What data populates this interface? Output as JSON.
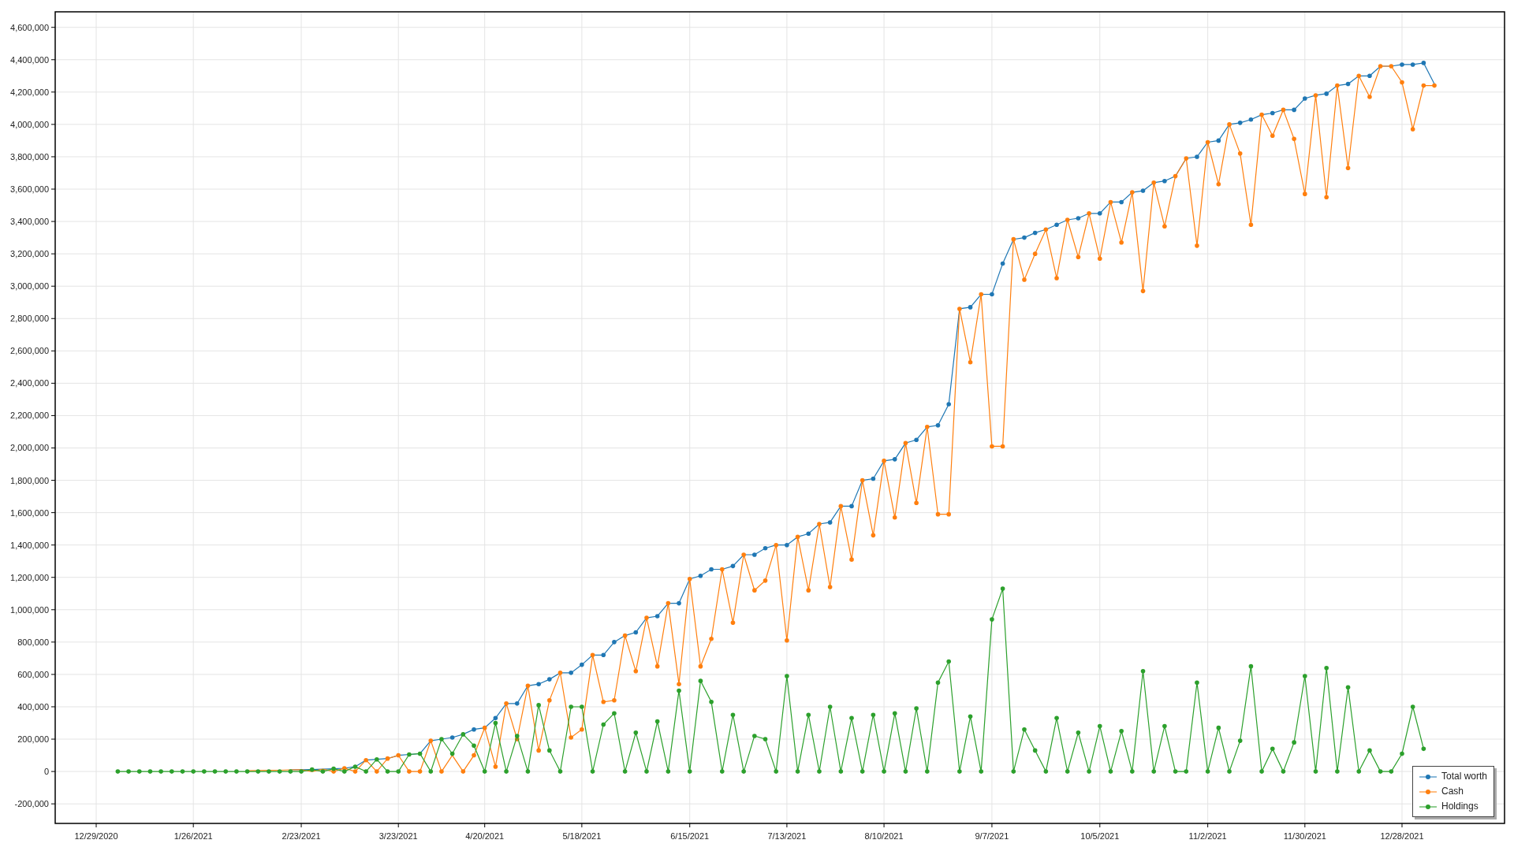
{
  "chart": {
    "chart_data": {
      "type": "line",
      "categories": [
        "12/29/2020",
        null,
        null,
        null,
        null,
        null,
        null,
        null,
        null,
        "1/26/2021",
        null,
        null,
        null,
        null,
        null,
        null,
        null,
        null,
        null,
        "2/23/2021",
        null,
        null,
        null,
        null,
        null,
        null,
        null,
        null,
        "3/23/2021",
        null,
        null,
        null,
        null,
        null,
        null,
        null,
        "4/20/2021",
        null,
        null,
        null,
        null,
        null,
        null,
        null,
        null,
        "5/18/2021",
        null,
        null,
        null,
        null,
        null,
        null,
        null,
        null,
        null,
        "6/15/2021",
        null,
        null,
        null,
        null,
        null,
        null,
        null,
        null,
        "7/13/2021",
        null,
        null,
        null,
        null,
        null,
        null,
        null,
        null,
        "8/10/2021",
        null,
        null,
        null,
        null,
        null,
        null,
        null,
        null,
        null,
        "9/7/2021",
        null,
        null,
        null,
        null,
        null,
        null,
        null,
        null,
        null,
        "10/5/2021",
        null,
        null,
        null,
        null,
        null,
        null,
        null,
        null,
        null,
        "11/2/2021",
        null,
        null,
        null,
        null,
        null,
        null,
        null,
        null,
        "11/30/2021",
        null,
        null,
        null,
        null,
        null,
        null,
        null,
        null,
        "12/28/2021",
        null,
        null,
        null
      ],
      "series": [
        {
          "name": "Total worth",
          "color": "#1f77b4",
          "values": [
            null,
            null,
            null,
            null,
            null,
            null,
            null,
            null,
            null,
            null,
            null,
            null,
            null,
            null,
            null,
            null,
            null,
            null,
            10000,
            11000,
            12000,
            14000,
            17000,
            20000,
            30000,
            70000,
            75000,
            80000,
            100000,
            105000,
            110000,
            190000,
            200000,
            210000,
            230000,
            260000,
            270000,
            330000,
            420000,
            420000,
            530000,
            540000,
            570000,
            610000,
            610000,
            660000,
            720000,
            720000,
            800000,
            840000,
            860000,
            950000,
            960000,
            1040000,
            1040000,
            1190000,
            1210000,
            1250000,
            1250000,
            1270000,
            1340000,
            1340000,
            1380000,
            1400000,
            1400000,
            1450000,
            1470000,
            1530000,
            1540000,
            1640000,
            1640000,
            1800000,
            1810000,
            1920000,
            1930000,
            2030000,
            2050000,
            2130000,
            2140000,
            2270000,
            2860000,
            2870000,
            2950000,
            2950000,
            3140000,
            3290000,
            3300000,
            3330000,
            3350000,
            3380000,
            3410000,
            3420000,
            3450000,
            3450000,
            3520000,
            3520000,
            3580000,
            3590000,
            3640000,
            3650000,
            3680000,
            3790000,
            3800000,
            3890000,
            3900000,
            4000000,
            4010000,
            4030000,
            4060000,
            4070000,
            4090000,
            4090000,
            4160000,
            4180000,
            4190000,
            4240000,
            4250000,
            4300000,
            4300000,
            4360000,
            4360000,
            4370000,
            4370000,
            4380000,
            4250000
          ]
        },
        {
          "name": "Cash",
          "color": "#ff7f0e",
          "values": [
            null,
            null,
            null,
            null,
            null,
            null,
            null,
            null,
            null,
            null,
            null,
            null,
            null,
            null,
            5000,
            6000,
            7000,
            8000,
            10000,
            11000,
            0,
            14000,
            0,
            20000,
            0,
            70000,
            0,
            80000,
            100000,
            0,
            0,
            190000,
            0,
            100000,
            0,
            100000,
            270000,
            30000,
            420000,
            200000,
            530000,
            130000,
            440000,
            610000,
            210000,
            260000,
            720000,
            430000,
            440000,
            840000,
            620000,
            950000,
            650000,
            1040000,
            540000,
            1190000,
            650000,
            820000,
            1250000,
            920000,
            1340000,
            1120000,
            1180000,
            1400000,
            810000,
            1450000,
            1120000,
            1530000,
            1140000,
            1640000,
            1310000,
            1800000,
            1460000,
            1920000,
            1570000,
            2030000,
            1660000,
            2130000,
            1590000,
            1590000,
            2860000,
            2530000,
            2950000,
            2010000,
            2010000,
            3290000,
            3040000,
            3200000,
            3350000,
            3050000,
            3410000,
            3180000,
            3450000,
            3170000,
            3520000,
            3270000,
            3580000,
            2970000,
            3640000,
            3370000,
            3680000,
            3790000,
            3250000,
            3890000,
            3630000,
            4000000,
            3820000,
            3380000,
            4060000,
            3930000,
            4090000,
            3910000,
            3570000,
            4180000,
            3550000,
            4240000,
            3730000,
            4300000,
            4170000,
            4360000,
            4360000,
            4260000,
            3970000,
            4240000,
            4240000
          ]
        },
        {
          "name": "Holdings",
          "color": "#2ca02c",
          "values": [
            null,
            null,
            0,
            0,
            0,
            0,
            0,
            0,
            0,
            0,
            0,
            0,
            0,
            0,
            0,
            0,
            0,
            0,
            0,
            0,
            12000,
            0,
            17000,
            0,
            30000,
            0,
            75000,
            0,
            0,
            105000,
            110000,
            0,
            200000,
            110000,
            230000,
            160000,
            0,
            300000,
            0,
            220000,
            0,
            410000,
            130000,
            0,
            400000,
            400000,
            0,
            290000,
            360000,
            0,
            240000,
            0,
            310000,
            0,
            500000,
            0,
            560000,
            430000,
            0,
            350000,
            0,
            220000,
            200000,
            0,
            590000,
            0,
            350000,
            0,
            400000,
            0,
            330000,
            0,
            350000,
            0,
            360000,
            0,
            390000,
            0,
            550000,
            680000,
            0,
            340000,
            0,
            940000,
            1130000,
            0,
            260000,
            130000,
            0,
            330000,
            0,
            240000,
            0,
            280000,
            0,
            250000,
            0,
            620000,
            0,
            280000,
            0,
            0,
            550000,
            0,
            270000,
            0,
            190000,
            650000,
            0,
            140000,
            0,
            180000,
            590000,
            0,
            640000,
            0,
            520000,
            0,
            130000,
            0,
            0,
            110000,
            400000,
            140000,
            null
          ]
        }
      ],
      "grid": true,
      "ylim": [
        -321000,
        4696000
      ],
      "yticks": [
        {
          "value": -200000,
          "label": "-200,000"
        },
        {
          "value": 0,
          "label": "0"
        },
        {
          "value": 200000,
          "label": "200,000"
        },
        {
          "value": 400000,
          "label": "400,000"
        },
        {
          "value": 600000,
          "label": "600,000"
        },
        {
          "value": 800000,
          "label": "800,000"
        },
        {
          "value": 1000000,
          "label": "1,000,000"
        },
        {
          "value": 1200000,
          "label": "1,200,000"
        },
        {
          "value": 1400000,
          "label": "1,400,000"
        },
        {
          "value": 1600000,
          "label": "1,600,000"
        },
        {
          "value": 1800000,
          "label": "1,800,000"
        },
        {
          "value": 2000000,
          "label": "2,000,000"
        },
        {
          "value": 2200000,
          "label": "2,200,000"
        },
        {
          "value": 2400000,
          "label": "2,400,000"
        },
        {
          "value": 2600000,
          "label": "2,600,000"
        },
        {
          "value": 2800000,
          "label": "2,800,000"
        },
        {
          "value": 3000000,
          "label": "3,000,000"
        },
        {
          "value": 3200000,
          "label": "3,200,000"
        },
        {
          "value": 3400000,
          "label": "3,400,000"
        },
        {
          "value": 3600000,
          "label": "3,600,000"
        },
        {
          "value": 3800000,
          "label": "3,800,000"
        },
        {
          "value": 4000000,
          "label": "4,000,000"
        },
        {
          "value": 4200000,
          "label": "4,200,000"
        },
        {
          "value": 4400000,
          "label": "4,400,000"
        },
        {
          "value": 4600000,
          "label": "4,600,000"
        }
      ]
    }
  }
}
